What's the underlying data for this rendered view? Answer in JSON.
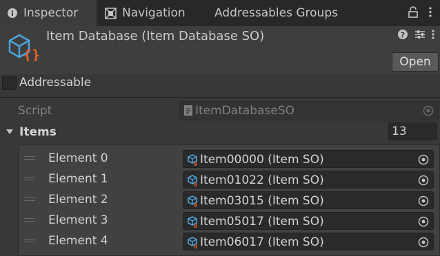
{
  "tabs": [
    {
      "label": "Inspector",
      "icon": "info-icon"
    },
    {
      "label": "Navigation",
      "icon": "navigation-icon"
    },
    {
      "label": "Addressables Groups"
    }
  ],
  "header": {
    "title": "Item Database (Item Database SO)",
    "open_label": "Open",
    "icons": [
      "help-icon",
      "preset-icon",
      "more-icon"
    ]
  },
  "addressable": {
    "label": "Addressable",
    "checked": false
  },
  "script": {
    "label": "Script",
    "value": "ItemDatabaseSO"
  },
  "items": {
    "label": "Items",
    "count": "13",
    "expanded": true,
    "elements": [
      {
        "label": "Element 0",
        "value": "Item00000 (Item SO)"
      },
      {
        "label": "Element 1",
        "value": "Item01022 (Item SO)"
      },
      {
        "label": "Element 2",
        "value": "Item03015 (Item SO)"
      },
      {
        "label": "Element 3",
        "value": "Item05017 (Item SO)"
      },
      {
        "label": "Element 4",
        "value": "Item06017 (Item SO)"
      }
    ]
  },
  "colors": {
    "background": "#383838",
    "tab_bar": "#282828",
    "active_tab": "#3c3c3c",
    "field": "#2a2a2a",
    "asset_icon_blue": "#4fa3d8",
    "asset_icon_orange": "#e8622c"
  }
}
